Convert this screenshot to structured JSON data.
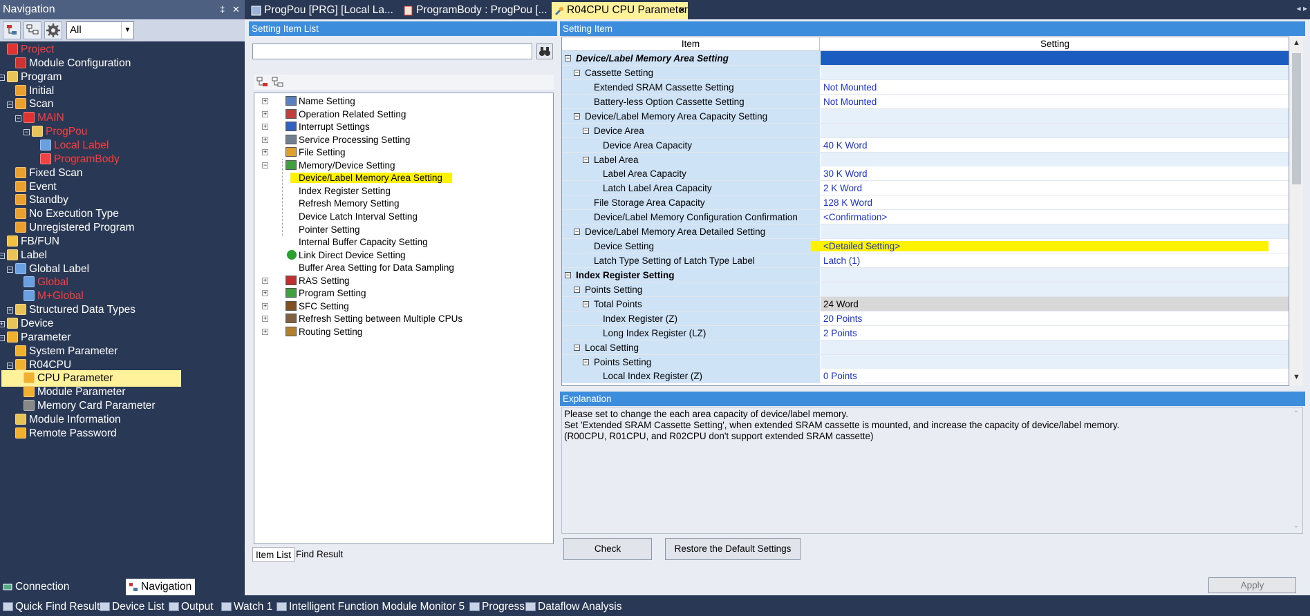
{
  "nav": {
    "title": "Navigation",
    "pin": "‡",
    "close": "✕",
    "filter_value": "All",
    "items": [
      {
        "label": "Project",
        "red": true,
        "icon": "project"
      },
      {
        "label": "Module Configuration",
        "icon": "module"
      },
      {
        "label": "Program",
        "icon": "folder"
      },
      {
        "label": "Initial",
        "icon": "task"
      },
      {
        "label": "Scan",
        "icon": "task"
      },
      {
        "label": "MAIN",
        "red": true,
        "icon": "program"
      },
      {
        "label": "ProgPou",
        "red": true,
        "icon": "pou"
      },
      {
        "label": "Local Label",
        "red": true,
        "icon": "label"
      },
      {
        "label": "ProgramBody",
        "red": true,
        "icon": "body"
      },
      {
        "label": "Fixed Scan",
        "icon": "task"
      },
      {
        "label": "Event",
        "icon": "task"
      },
      {
        "label": "Standby",
        "icon": "task"
      },
      {
        "label": "No Execution Type",
        "icon": "task"
      },
      {
        "label": "Unregistered Program",
        "icon": "task"
      },
      {
        "label": "FB/FUN",
        "icon": "fb"
      },
      {
        "label": "Label",
        "icon": "folder"
      },
      {
        "label": "Global Label",
        "icon": "label"
      },
      {
        "label": "Global",
        "red": true,
        "icon": "global"
      },
      {
        "label": "M+Global",
        "red": true,
        "icon": "global"
      },
      {
        "label": "Structured Data Types",
        "icon": "struct"
      },
      {
        "label": "Device",
        "icon": "device"
      },
      {
        "label": "Parameter",
        "icon": "param"
      },
      {
        "label": "System Parameter",
        "icon": "param"
      },
      {
        "label": "R04CPU",
        "icon": "param"
      },
      {
        "label": "CPU Parameter",
        "selected": true,
        "icon": "param"
      },
      {
        "label": "Module Parameter",
        "icon": "param"
      },
      {
        "label": "Memory Card Parameter",
        "icon": "card"
      },
      {
        "label": "Module Information",
        "icon": "info"
      },
      {
        "label": "Remote Password",
        "icon": "param"
      }
    ],
    "bottom_tabs": [
      "Connection Destination",
      "Navigation"
    ]
  },
  "doc_tabs": [
    {
      "label": "ProgPou [PRG] [Local La..."
    },
    {
      "label": "ProgramBody : ProgPou [..."
    },
    {
      "label": "R04CPU CPU Parameter",
      "active": true
    }
  ],
  "doc_tab_close": "✕",
  "doc_nav": "◂ ▸",
  "setting_item_list": {
    "title": "Setting Item List",
    "search_value": "",
    "items": [
      {
        "label": "Name Setting",
        "expander": "+"
      },
      {
        "label": "Operation Related Setting",
        "expander": "+"
      },
      {
        "label": "Interrupt Settings",
        "expander": "+"
      },
      {
        "label": "Service Processing Setting",
        "expander": "+"
      },
      {
        "label": "File Setting",
        "expander": "+"
      },
      {
        "label": "Memory/Device Setting",
        "expander": "−"
      },
      {
        "label": "Device/Label Memory Area Setting",
        "child": true,
        "highlight": true
      },
      {
        "label": "Index Register Setting",
        "child": true
      },
      {
        "label": "Refresh Memory Setting",
        "child": true
      },
      {
        "label": "Device Latch Interval Setting",
        "child": true
      },
      {
        "label": "Pointer Setting",
        "child": true
      },
      {
        "label": "Internal Buffer Capacity Setting",
        "child": true
      },
      {
        "label": "Link Direct Device Setting",
        "child": true,
        "check": true
      },
      {
        "label": "Buffer Area Setting for Data Sampling",
        "child": true
      },
      {
        "label": "RAS Setting",
        "expander": "+"
      },
      {
        "label": "Program Setting",
        "expander": "+"
      },
      {
        "label": "SFC Setting",
        "expander": "+"
      },
      {
        "label": "Refresh Setting between Multiple CPUs",
        "expander": "+"
      },
      {
        "label": "Routing Setting",
        "expander": "+"
      }
    ],
    "tabs": [
      "Item List",
      "Find Result"
    ]
  },
  "setting_item": {
    "title": "Setting Item",
    "col_item": "Item",
    "col_setting": "Setting",
    "rows": [
      {
        "level": 0,
        "label": "Device/Label Memory Area Setting",
        "style": "bi",
        "value": "",
        "section": true
      },
      {
        "level": 1,
        "label": "Cassette Setting",
        "value": ""
      },
      {
        "level": 2,
        "label": "Extended SRAM Cassette Setting",
        "value": "Not Mounted"
      },
      {
        "level": 2,
        "label": "Battery-less Option Cassette Setting",
        "value": "Not Mounted"
      },
      {
        "level": 1,
        "label": "Device/Label Memory Area Capacity Setting",
        "value": ""
      },
      {
        "level": 2,
        "label": "Device Area",
        "value": "",
        "exp": true
      },
      {
        "level": 3,
        "label": "Device Area Capacity",
        "value": "40 K Word"
      },
      {
        "level": 2,
        "label": "Label Area",
        "value": "",
        "exp": true
      },
      {
        "level": 3,
        "label": "Label Area Capacity",
        "value": "30 K Word"
      },
      {
        "level": 3,
        "label": "Latch Label Area Capacity",
        "value": "2 K Word"
      },
      {
        "level": 2,
        "label": "File Storage Area Capacity",
        "value": "128 K Word"
      },
      {
        "level": 2,
        "label": "Device/Label Memory Configuration Confirmation",
        "value": "<Confirmation>"
      },
      {
        "level": 1,
        "label": "Device/Label Memory Area Detailed Setting",
        "value": ""
      },
      {
        "level": 2,
        "label": "Device Setting",
        "value": "<Detailed Setting>",
        "highlight": true
      },
      {
        "level": 2,
        "label": "Latch Type Setting of Latch Type Label",
        "value": "Latch (1)"
      },
      {
        "level": 0,
        "label": "Index Register Setting",
        "style": "b",
        "value": ""
      },
      {
        "level": 1,
        "label": "Points Setting",
        "value": ""
      },
      {
        "level": 2,
        "label": "Total Points",
        "value": "24 Word",
        "exp": true,
        "readonly": true
      },
      {
        "level": 3,
        "label": "Index Register (Z)",
        "value": "20 Points"
      },
      {
        "level": 3,
        "label": "Long Index Register (LZ)",
        "value": "2 Points"
      },
      {
        "level": 1,
        "label": "Local Setting",
        "value": ""
      },
      {
        "level": 2,
        "label": "Points Setting",
        "value": "",
        "exp": true
      },
      {
        "level": 3,
        "label": "Local Index Register (Z)",
        "value": "0 Points"
      }
    ]
  },
  "explanation": {
    "title": "Explanation",
    "lines": [
      "Please set to change the each area capacity of device/label memory.",
      "Set 'Extended SRAM Cassette Setting', when extended SRAM cassette is mounted, and increase the capacity of device/label memory.",
      "(R00CPU, R01CPU, and R02CPU don't support extended SRAM cassette)"
    ]
  },
  "buttons": {
    "check": "Check",
    "restore": "Restore the Default Settings",
    "apply": "Apply"
  },
  "status_tabs": [
    {
      "label": "Quick Find Result",
      "icon": "find"
    },
    {
      "label": "Device List",
      "icon": "DEV"
    },
    {
      "label": "Output",
      "icon": "out"
    },
    {
      "label": "Watch 1",
      "icon": "DEV"
    },
    {
      "label": "Intelligent Function Module Monitor 5",
      "icon": "DEV"
    },
    {
      "label": "Progress",
      "icon": "prog"
    },
    {
      "label": "Dataflow Analysis",
      "icon": "DFA"
    }
  ]
}
